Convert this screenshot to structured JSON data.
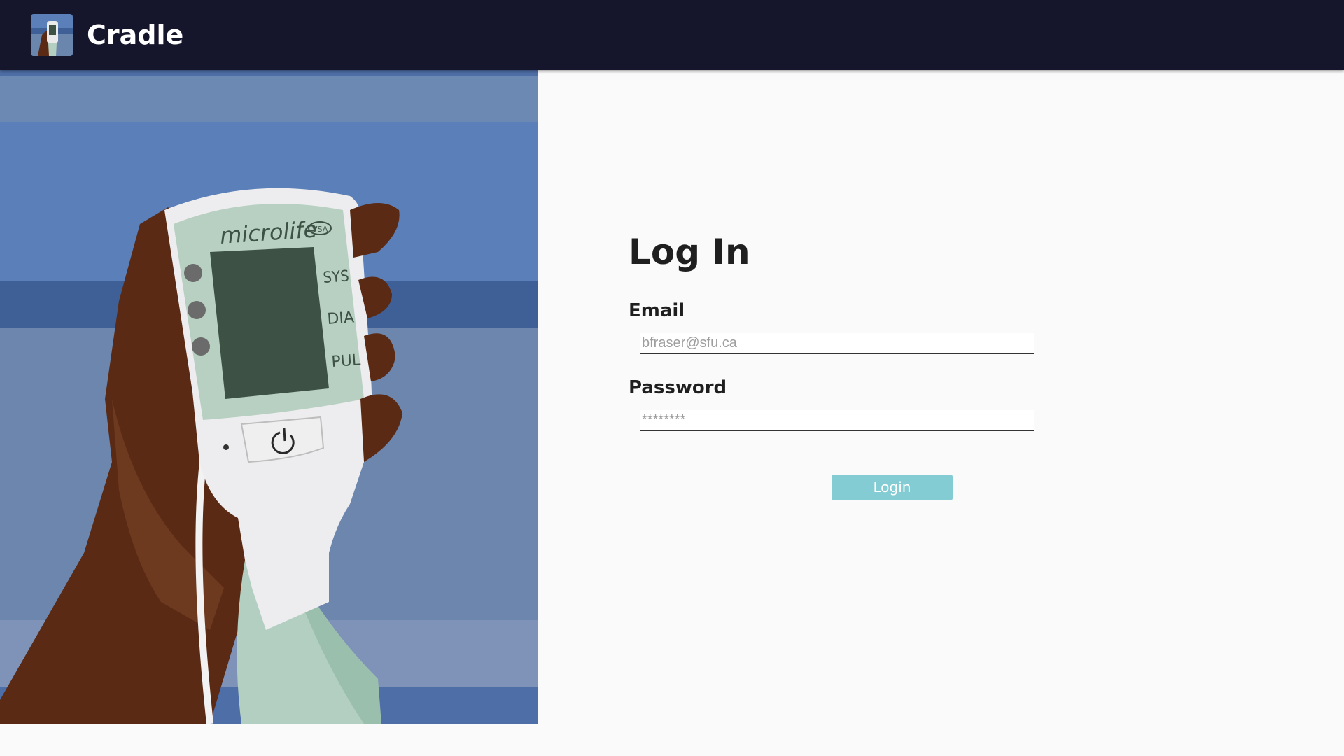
{
  "header": {
    "app_title": "Cradle",
    "logo_icon": "cradle-logo-icon"
  },
  "hero": {
    "device_brand": "microlife",
    "device_badge": "VSA",
    "readout_labels": [
      "SYS",
      "DIA",
      "PUL"
    ],
    "power_icon": "power-icon"
  },
  "login_form": {
    "heading": "Log In",
    "email_label": "Email",
    "email_placeholder": "bfraser@sfu.ca",
    "email_value": "",
    "password_label": "Password",
    "password_placeholder": "********",
    "password_value": "",
    "submit_label": "Login"
  },
  "colors": {
    "header_bg": "#15162c",
    "page_bg": "#fafafa",
    "button_bg": "#84ccd3",
    "hero_blue": "#5b7fb8",
    "device_screen": "#3d5244",
    "skin": "#5a2a14"
  }
}
